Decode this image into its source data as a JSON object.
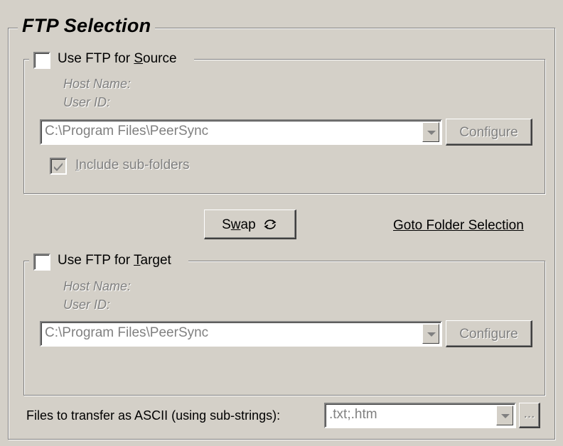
{
  "ftp_selection": {
    "title": "FTP Selection",
    "source": {
      "checkbox_label_pre": "Use FTP for ",
      "checkbox_label_key": "S",
      "checkbox_label_post": "ource",
      "checked": false,
      "host_name_label": "Host Name:",
      "user_id_label": "User ID:",
      "path_value": "C:\\Program Files\\PeerSync",
      "configure_label": "Configure",
      "include_subfolders_pre": "",
      "include_subfolders_key": "I",
      "include_subfolders_post": "nclude sub-folders",
      "include_subfolders_checked": true
    },
    "swap": {
      "label_pre": "S",
      "label_key": "w",
      "label_post": "ap",
      "icon": "swap-arrows-icon"
    },
    "goto_folder_selection": "Goto Folder Selection",
    "target": {
      "checkbox_label_pre": "Use FTP for ",
      "checkbox_label_key": "T",
      "checkbox_label_post": "arget",
      "checked": false,
      "host_name_label": "Host Name:",
      "user_id_label": "User ID:",
      "path_value": "C:\\Program Files\\PeerSync",
      "configure_label": "Configure"
    },
    "ascii": {
      "label": "Files to transfer as ASCII (using sub-strings):",
      "value": ".txt;.htm",
      "browse_label": "..."
    }
  }
}
